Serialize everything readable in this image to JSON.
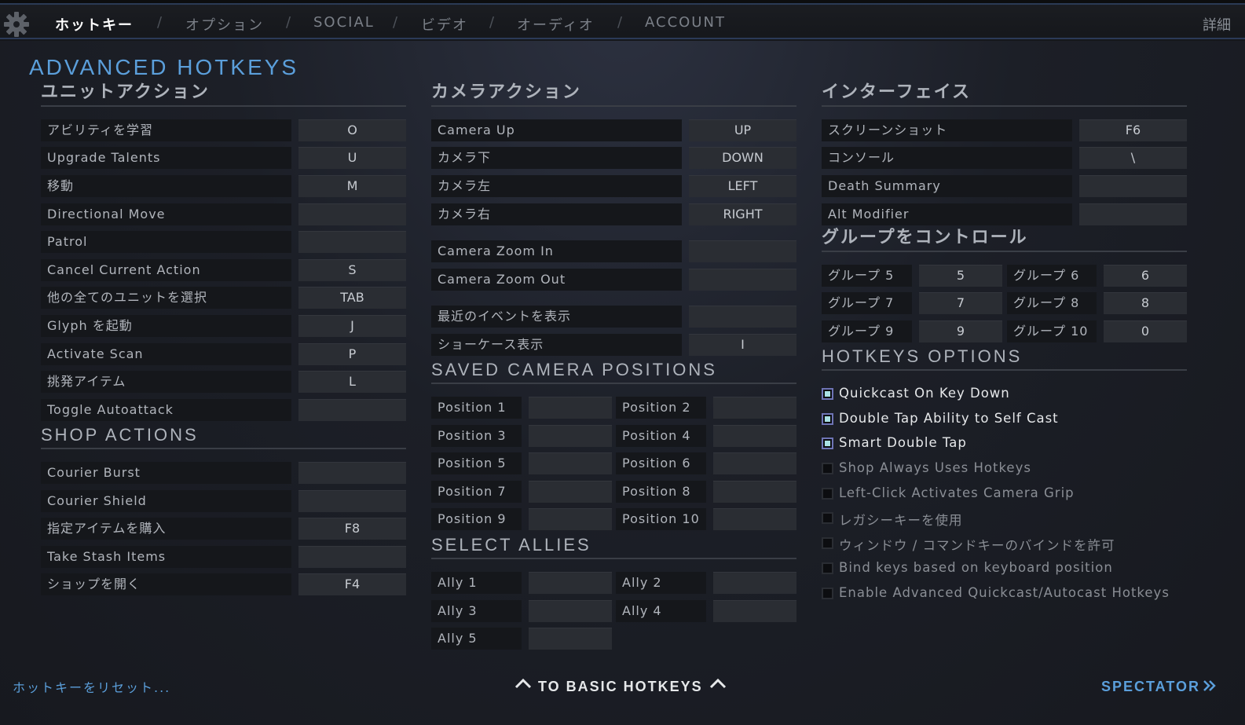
{
  "nav": {
    "tabs": [
      {
        "label": "ホットキー",
        "active": true
      },
      {
        "label": "オプション"
      },
      {
        "label": "SOCIAL"
      },
      {
        "label": "ビデオ"
      },
      {
        "label": "オーディオ"
      },
      {
        "label": "ACCOUNT"
      }
    ],
    "separator": "/",
    "detail_label": "詳細"
  },
  "page_title": "ADVANCED HOTKEYS",
  "unit_actions": {
    "title": "ユニットアクション",
    "rows": [
      {
        "label": "アビリティを学習",
        "key": "O"
      },
      {
        "label": "Upgrade Talents",
        "key": "U"
      },
      {
        "label": "移動",
        "key": "M"
      },
      {
        "label": "Directional Move",
        "key": ""
      },
      {
        "label": "Patrol",
        "key": ""
      },
      {
        "label": "Cancel Current Action",
        "key": "S"
      },
      {
        "label": "他の全てのユニットを選択",
        "key": "TAB"
      },
      {
        "label": "Glyph を起動",
        "key": "J"
      },
      {
        "label": "Activate Scan",
        "key": "P"
      },
      {
        "label": "挑発アイテム",
        "key": "L"
      },
      {
        "label": "Toggle Autoattack",
        "key": ""
      }
    ]
  },
  "shop_actions": {
    "title": "SHOP ACTIONS",
    "rows": [
      {
        "label": "Courier Burst",
        "key": ""
      },
      {
        "label": "Courier Shield",
        "key": ""
      },
      {
        "label": "指定アイテムを購入",
        "key": "F8"
      },
      {
        "label": "Take Stash Items",
        "key": ""
      },
      {
        "label": "ショップを開く",
        "key": "F4"
      }
    ]
  },
  "camera_actions": {
    "title": "カメラアクション",
    "rows": [
      {
        "label": "Camera Up",
        "key": "UP"
      },
      {
        "label": "カメラ下",
        "key": "DOWN"
      },
      {
        "label": "カメラ左",
        "key": "LEFT"
      },
      {
        "label": "カメラ右",
        "key": "RIGHT"
      },
      {
        "label": "Camera Zoom In",
        "key": ""
      },
      {
        "label": "Camera Zoom Out",
        "key": ""
      },
      {
        "label": "最近のイベントを表示",
        "key": ""
      },
      {
        "label": "ショーケース表示",
        "key": "I"
      }
    ]
  },
  "saved_camera": {
    "title": "SAVED CAMERA POSITIONS",
    "items": [
      {
        "label": "Position 1",
        "key": ""
      },
      {
        "label": "Position 2",
        "key": ""
      },
      {
        "label": "Position 3",
        "key": ""
      },
      {
        "label": "Position 4",
        "key": ""
      },
      {
        "label": "Position 5",
        "key": ""
      },
      {
        "label": "Position 6",
        "key": ""
      },
      {
        "label": "Position 7",
        "key": ""
      },
      {
        "label": "Position 8",
        "key": ""
      },
      {
        "label": "Position 9",
        "key": ""
      },
      {
        "label": "Position 10",
        "key": ""
      }
    ]
  },
  "select_allies": {
    "title": "SELECT ALLIES",
    "items": [
      {
        "label": "Ally 1",
        "key": ""
      },
      {
        "label": "Ally 2",
        "key": ""
      },
      {
        "label": "Ally 3",
        "key": ""
      },
      {
        "label": "Ally 4",
        "key": ""
      },
      {
        "label": "Ally 5",
        "key": ""
      }
    ]
  },
  "interface": {
    "title": "インターフェイス",
    "rows": [
      {
        "label": "スクリーンショット",
        "key": "F6"
      },
      {
        "label": "コンソール",
        "key": "\\"
      },
      {
        "label": "Death Summary",
        "key": ""
      },
      {
        "label": "Alt Modifier",
        "key": ""
      }
    ]
  },
  "control_groups": {
    "title": "グループをコントロール",
    "items": [
      {
        "label": "グループ 5",
        "key": "5"
      },
      {
        "label": "グループ 6",
        "key": "6"
      },
      {
        "label": "グループ 7",
        "key": "7"
      },
      {
        "label": "グループ 8",
        "key": "8"
      },
      {
        "label": "グループ 9",
        "key": "9"
      },
      {
        "label": "グループ 10",
        "key": "0"
      }
    ]
  },
  "hotkey_options": {
    "title": "HOTKEYS OPTIONS",
    "items": [
      {
        "label": "Quickcast On Key Down",
        "checked": true
      },
      {
        "label": "Double Tap Ability to Self Cast",
        "checked": true
      },
      {
        "label": "Smart Double Tap",
        "checked": true
      },
      {
        "label": "Shop Always Uses Hotkeys",
        "checked": false
      },
      {
        "label": "Left-Click Activates Camera Grip",
        "checked": false
      },
      {
        "label": "レガシーキーを使用",
        "checked": false
      },
      {
        "label": "ウィンドウ / コマンドキーのバインドを許可",
        "checked": false
      },
      {
        "label": "Bind keys based on keyboard position",
        "checked": false
      },
      {
        "label": "Enable Advanced Quickcast/Autocast Hotkeys",
        "checked": false
      }
    ]
  },
  "footer": {
    "reset_label": "ホットキーをリセット...",
    "basic_label": "TO BASIC HOTKEYS",
    "spectator_label": "SPECTATOR"
  },
  "colors": {
    "accent": "#5b9fdb",
    "check_fill": "#a9e1e4",
    "check_border": "#6e74b5"
  },
  "icons": [
    "gear-icon",
    "chevron-up-icon",
    "double-chevron-right-icon"
  ]
}
